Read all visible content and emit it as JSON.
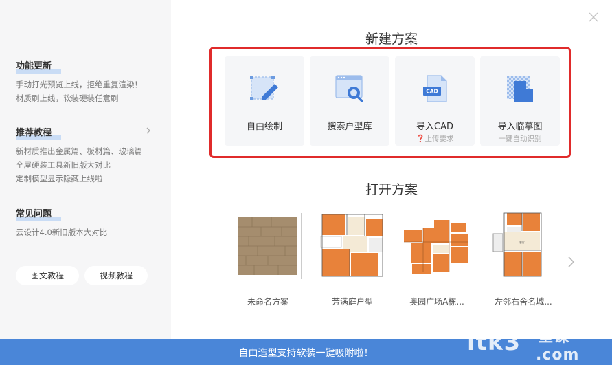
{
  "sidebar": {
    "features": {
      "title": "功能更新",
      "lines": [
        "手动打光预览上线，拒绝重复渲染！",
        "材质刷上线，软装硬装任意刷"
      ]
    },
    "tutorials": {
      "title": "推荐教程",
      "lines": [
        "新材质推出金属篇、板材篇、玻璃篇",
        "全屋硬装工具新旧版大对比",
        "定制模型显示隐藏上线啦"
      ]
    },
    "faq": {
      "title": "常见问题",
      "lines": [
        "云设计4.0新旧版本大对比"
      ]
    },
    "buttons": {
      "graphic_tutorial": "图文教程",
      "video_tutorial": "视频教程"
    }
  },
  "new_plan": {
    "title": "新建方案",
    "cards": [
      {
        "label": "自由绘制",
        "sub": "",
        "icon": "pencil-draw-icon"
      },
      {
        "label": "搜索户型库",
        "sub": "",
        "icon": "search-floorplan-icon"
      },
      {
        "label": "导入CAD",
        "sub": "❓上传要求",
        "icon": "cad-file-icon"
      },
      {
        "label": "导入临摹图",
        "sub": "一键自动识别",
        "icon": "trace-image-icon"
      }
    ]
  },
  "open_plan": {
    "title": "打开方案",
    "plans": [
      {
        "label": "未命名方案"
      },
      {
        "label": "芳满庭户型"
      },
      {
        "label": "奥园广场A栋..."
      },
      {
        "label": "左邻右舍名城..."
      }
    ]
  },
  "footer": {
    "text": "自由造型支持软装一键吸附啦！"
  },
  "watermark": {
    "text": "itk3",
    "cn": "一堂课",
    "com": ".com"
  },
  "colors": {
    "accent": "#4a86d8",
    "highlight": "#c9dcf5",
    "red_box": "#e02b2b",
    "floorplan_orange": "#e8823a"
  }
}
